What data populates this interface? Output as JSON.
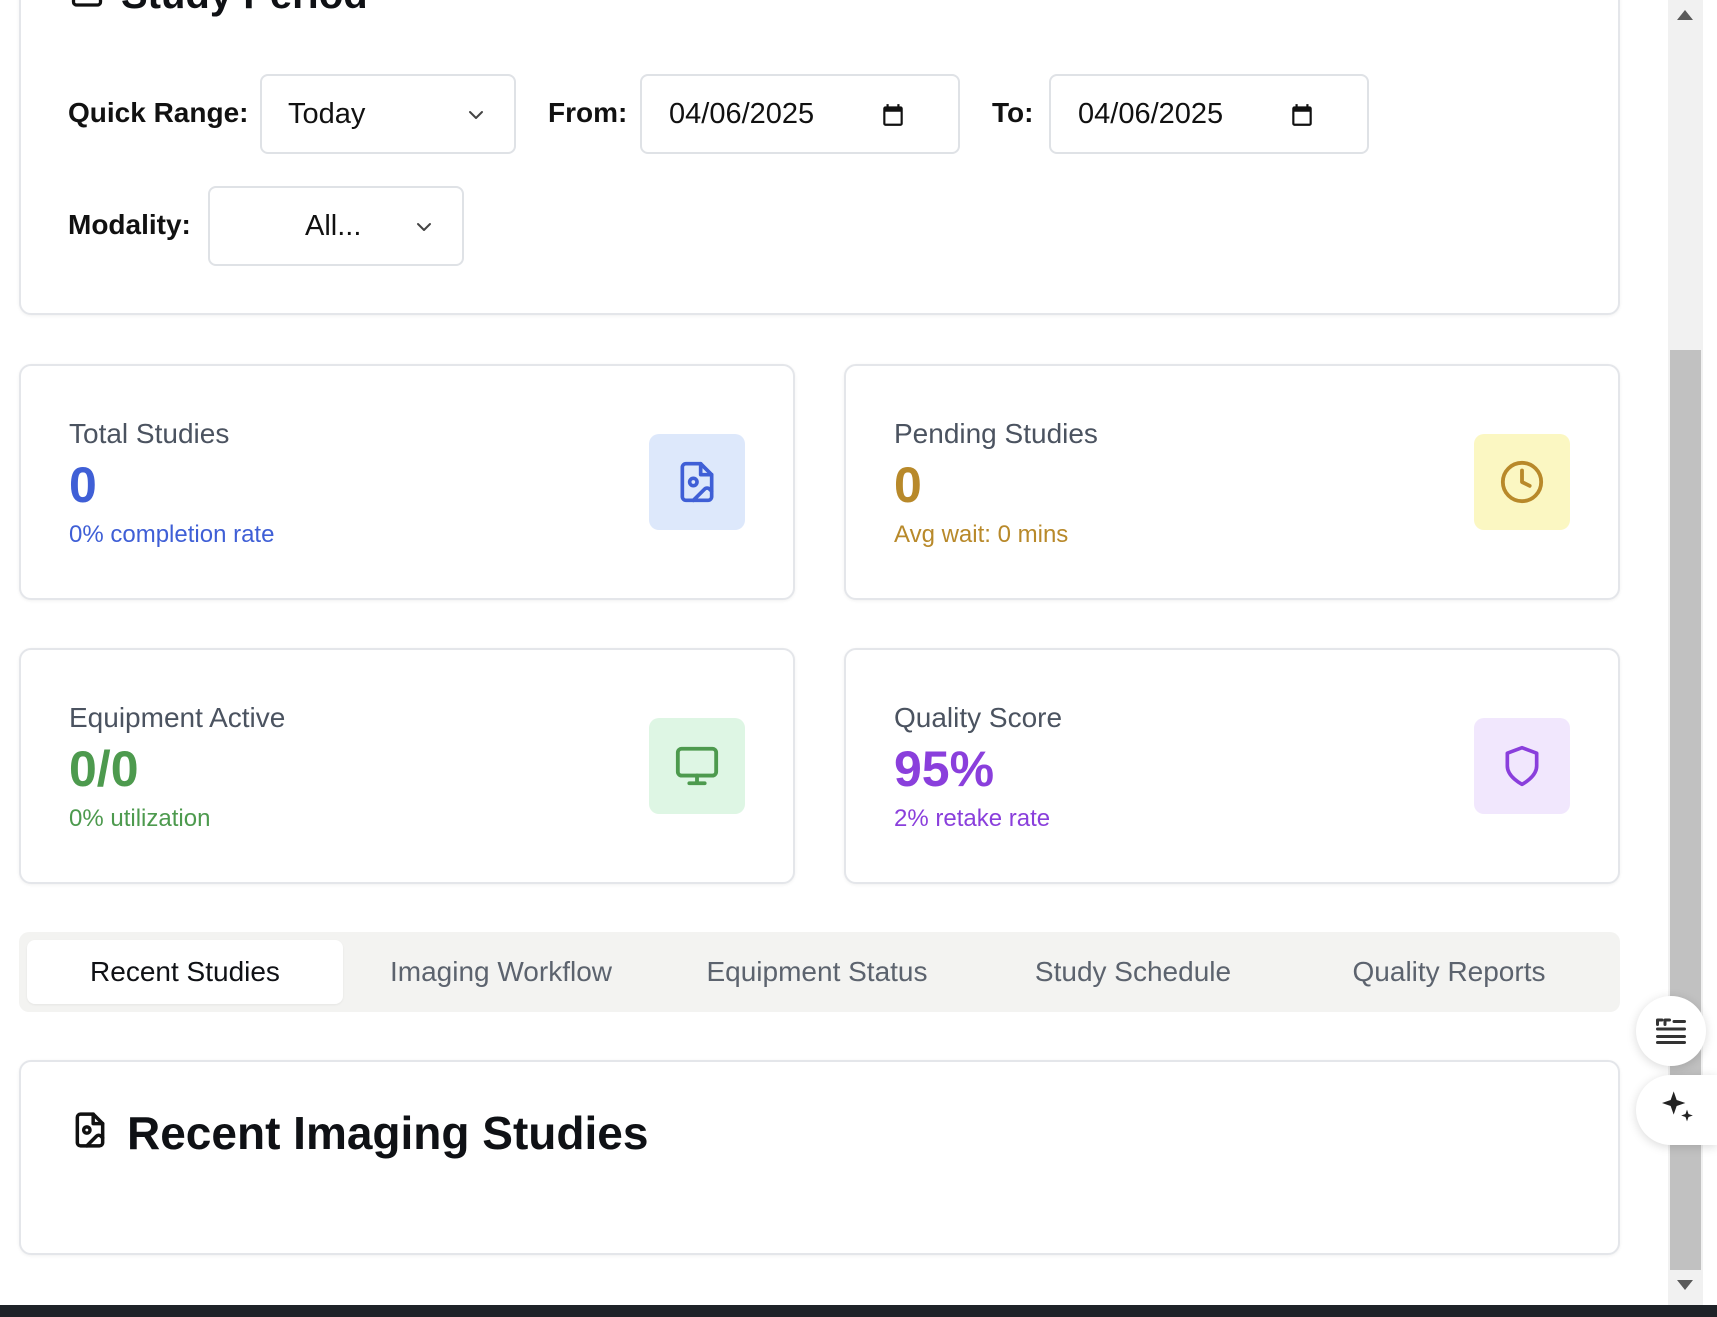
{
  "study_period": {
    "title": "Study Period",
    "quick_range_label": "Quick Range:",
    "quick_range_value": "Today",
    "from_label": "From:",
    "from_value": "04/06/2025",
    "to_label": "To:",
    "to_value": "04/06/2025",
    "modality_label": "Modality:",
    "modality_value": "All..."
  },
  "stats": [
    {
      "label": "Total Studies",
      "value": "0",
      "sub": "0% completion rate",
      "icon": "file-image-icon",
      "color": "#3f5fd6",
      "icon_bg": "#dde8fb"
    },
    {
      "label": "Pending Studies",
      "value": "0",
      "sub": "Avg wait: 0 mins",
      "icon": "clock-icon",
      "color": "#b8892a",
      "icon_bg": "#fbf7c2"
    },
    {
      "label": "Equipment Active",
      "value": "0/0",
      "sub": "0% utilization",
      "icon": "monitor-icon",
      "color": "#4d9a4e",
      "icon_bg": "#def6e4"
    },
    {
      "label": "Quality Score",
      "value": "95%",
      "sub": "2% retake rate",
      "icon": "shield-icon",
      "color": "#8a3fdc",
      "icon_bg": "#f1e7fd"
    }
  ],
  "tabs": [
    {
      "label": "Recent Studies",
      "active": true
    },
    {
      "label": "Imaging Workflow",
      "active": false
    },
    {
      "label": "Equipment Status",
      "active": false
    },
    {
      "label": "Study Schedule",
      "active": false
    },
    {
      "label": "Quality Reports",
      "active": false
    }
  ],
  "recent": {
    "title": "Recent Imaging Studies"
  }
}
